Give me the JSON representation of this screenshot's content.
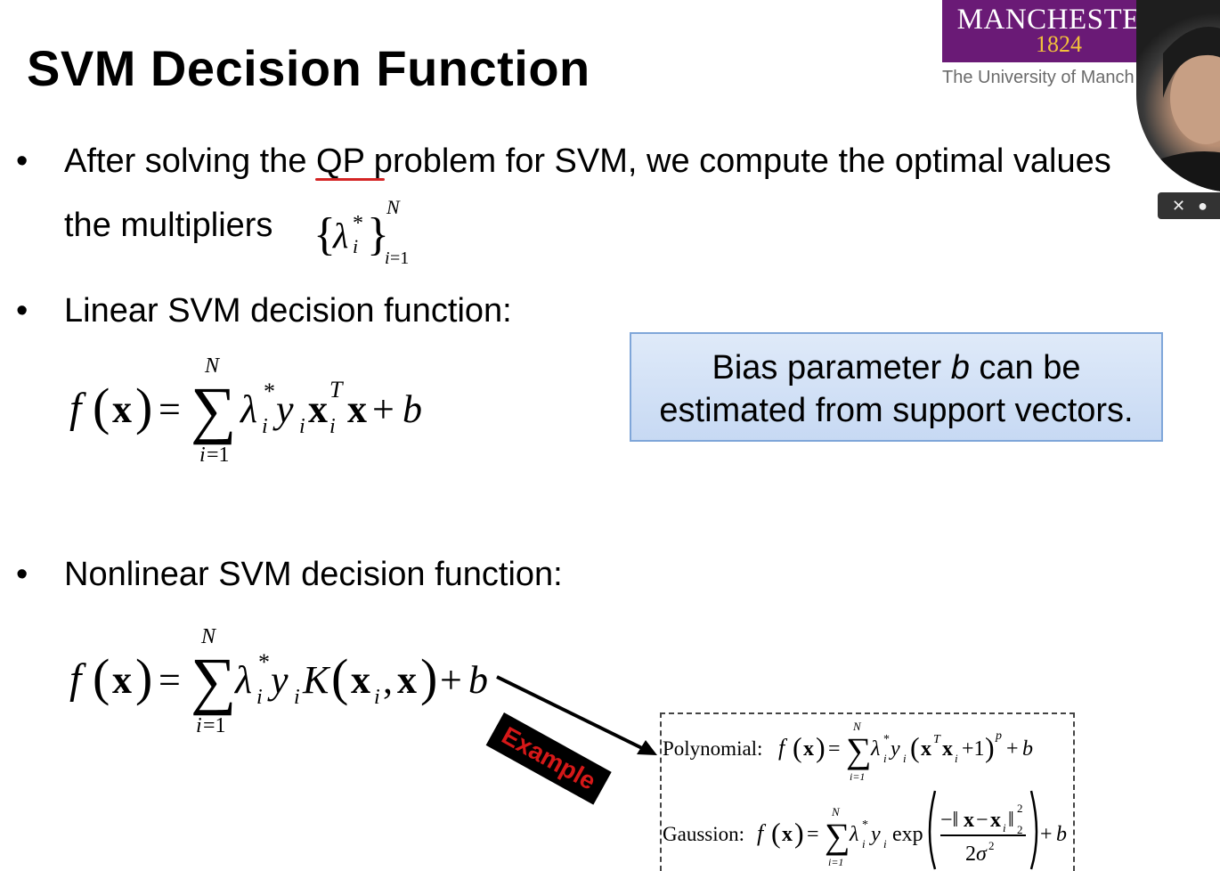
{
  "slide": {
    "title": "SVM Decision Function",
    "bullets": [
      {
        "line1": "After solving the QP problem for SVM, we compute the optimal values",
        "line2": "the multipliers"
      },
      {
        "text": "Linear SVM decision function:"
      },
      {
        "text": "Nonlinear SVM decision function:"
      }
    ],
    "bullet_glyph": "•",
    "note_box": {
      "line1_pre": "Bias parameter ",
      "line1_var": "b",
      "line1_post": " can be",
      "line2": "estimated from support vectors."
    },
    "example_label": "Example",
    "examples": {
      "polynomial_label": "Polynomial:",
      "gaussian_label": "Gaussion:"
    }
  },
  "logo": {
    "name": "MANCHESTER",
    "year": "1824",
    "subtitle": "The University of Manch"
  },
  "webcam": {
    "close_glyph": "✕",
    "dot_glyph": "●"
  },
  "colors": {
    "logo_bg": "#6a1a76",
    "note_border": "#7fa6d9",
    "example_text": "#d51818"
  }
}
